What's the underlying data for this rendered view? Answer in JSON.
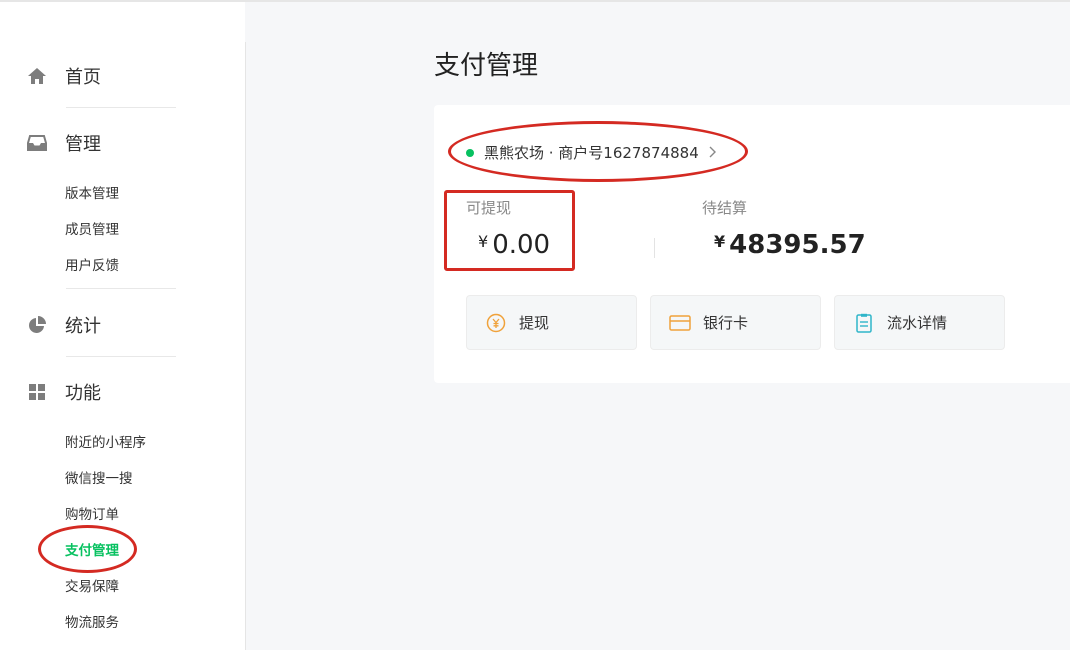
{
  "sidebar": {
    "sections": [
      {
        "label": "首页",
        "icon": "home-icon"
      },
      {
        "label": "管理",
        "icon": "inbox-icon",
        "items": [
          "版本管理",
          "成员管理",
          "用户反馈"
        ]
      },
      {
        "label": "统计",
        "icon": "pie-chart-icon"
      },
      {
        "label": "功能",
        "icon": "grid-icon",
        "items": [
          "附近的小程序",
          "微信搜一搜",
          "购物订单",
          "支付管理",
          "交易保障",
          "物流服务"
        ]
      }
    ],
    "active_item": "支付管理"
  },
  "main": {
    "title": "支付管理",
    "merchant": {
      "text": "黑熊农场 · 商户号1627874884",
      "status_color": "#07c160"
    },
    "available": {
      "label": "可提现",
      "currency": "¥",
      "amount": "0.00"
    },
    "pending": {
      "label": "待结算",
      "currency": "¥",
      "amount": "48395.57"
    },
    "buttons": [
      {
        "label": "提现",
        "icon": "yen-coin-icon"
      },
      {
        "label": "银行卡",
        "icon": "bank-card-icon"
      },
      {
        "label": "流水详情",
        "icon": "statement-list-icon"
      }
    ]
  },
  "colors": {
    "accent": "#07c160",
    "annotation": "#d42a22"
  }
}
